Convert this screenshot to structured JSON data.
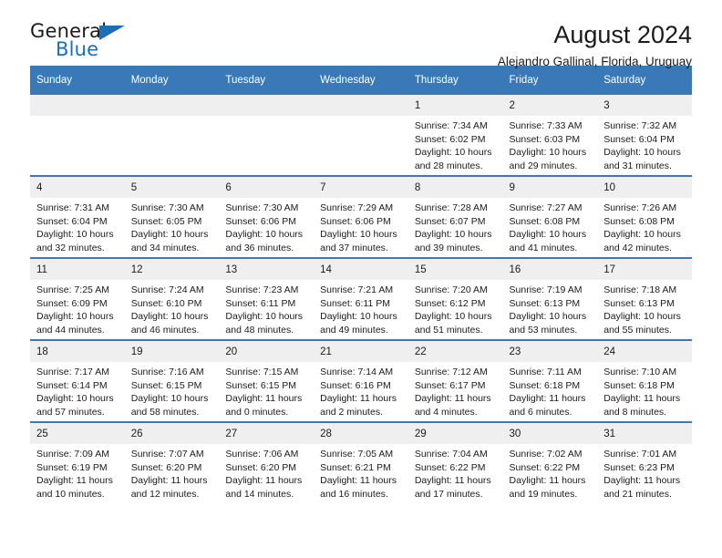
{
  "logo": {
    "word_top": "General",
    "word_bottom": "Blue",
    "icon": "triangle-icon",
    "accent_color": "#1a70b8"
  },
  "header": {
    "title": "August 2024",
    "subtitle": "Alejandro Gallinal, Florida, Uruguay"
  },
  "theme": {
    "header_blue": "#3a79b8",
    "daynum_gray": "#efefef",
    "text": "#1b1b1b"
  },
  "weekday_headers": [
    "Sunday",
    "Monday",
    "Tuesday",
    "Wednesday",
    "Thursday",
    "Friday",
    "Saturday"
  ],
  "weeks": [
    [
      {
        "day": "",
        "empty": true
      },
      {
        "day": "",
        "empty": true
      },
      {
        "day": "",
        "empty": true
      },
      {
        "day": "",
        "empty": true
      },
      {
        "day": "1",
        "sunrise": "Sunrise: 7:34 AM",
        "sunset": "Sunset: 6:02 PM",
        "daylight1": "Daylight: 10 hours",
        "daylight2": "and 28 minutes."
      },
      {
        "day": "2",
        "sunrise": "Sunrise: 7:33 AM",
        "sunset": "Sunset: 6:03 PM",
        "daylight1": "Daylight: 10 hours",
        "daylight2": "and 29 minutes."
      },
      {
        "day": "3",
        "sunrise": "Sunrise: 7:32 AM",
        "sunset": "Sunset: 6:04 PM",
        "daylight1": "Daylight: 10 hours",
        "daylight2": "and 31 minutes."
      }
    ],
    [
      {
        "day": "4",
        "sunrise": "Sunrise: 7:31 AM",
        "sunset": "Sunset: 6:04 PM",
        "daylight1": "Daylight: 10 hours",
        "daylight2": "and 32 minutes."
      },
      {
        "day": "5",
        "sunrise": "Sunrise: 7:30 AM",
        "sunset": "Sunset: 6:05 PM",
        "daylight1": "Daylight: 10 hours",
        "daylight2": "and 34 minutes."
      },
      {
        "day": "6",
        "sunrise": "Sunrise: 7:30 AM",
        "sunset": "Sunset: 6:06 PM",
        "daylight1": "Daylight: 10 hours",
        "daylight2": "and 36 minutes."
      },
      {
        "day": "7",
        "sunrise": "Sunrise: 7:29 AM",
        "sunset": "Sunset: 6:06 PM",
        "daylight1": "Daylight: 10 hours",
        "daylight2": "and 37 minutes."
      },
      {
        "day": "8",
        "sunrise": "Sunrise: 7:28 AM",
        "sunset": "Sunset: 6:07 PM",
        "daylight1": "Daylight: 10 hours",
        "daylight2": "and 39 minutes."
      },
      {
        "day": "9",
        "sunrise": "Sunrise: 7:27 AM",
        "sunset": "Sunset: 6:08 PM",
        "daylight1": "Daylight: 10 hours",
        "daylight2": "and 41 minutes."
      },
      {
        "day": "10",
        "sunrise": "Sunrise: 7:26 AM",
        "sunset": "Sunset: 6:08 PM",
        "daylight1": "Daylight: 10 hours",
        "daylight2": "and 42 minutes."
      }
    ],
    [
      {
        "day": "11",
        "sunrise": "Sunrise: 7:25 AM",
        "sunset": "Sunset: 6:09 PM",
        "daylight1": "Daylight: 10 hours",
        "daylight2": "and 44 minutes."
      },
      {
        "day": "12",
        "sunrise": "Sunrise: 7:24 AM",
        "sunset": "Sunset: 6:10 PM",
        "daylight1": "Daylight: 10 hours",
        "daylight2": "and 46 minutes."
      },
      {
        "day": "13",
        "sunrise": "Sunrise: 7:23 AM",
        "sunset": "Sunset: 6:11 PM",
        "daylight1": "Daylight: 10 hours",
        "daylight2": "and 48 minutes."
      },
      {
        "day": "14",
        "sunrise": "Sunrise: 7:21 AM",
        "sunset": "Sunset: 6:11 PM",
        "daylight1": "Daylight: 10 hours",
        "daylight2": "and 49 minutes."
      },
      {
        "day": "15",
        "sunrise": "Sunrise: 7:20 AM",
        "sunset": "Sunset: 6:12 PM",
        "daylight1": "Daylight: 10 hours",
        "daylight2": "and 51 minutes."
      },
      {
        "day": "16",
        "sunrise": "Sunrise: 7:19 AM",
        "sunset": "Sunset: 6:13 PM",
        "daylight1": "Daylight: 10 hours",
        "daylight2": "and 53 minutes."
      },
      {
        "day": "17",
        "sunrise": "Sunrise: 7:18 AM",
        "sunset": "Sunset: 6:13 PM",
        "daylight1": "Daylight: 10 hours",
        "daylight2": "and 55 minutes."
      }
    ],
    [
      {
        "day": "18",
        "sunrise": "Sunrise: 7:17 AM",
        "sunset": "Sunset: 6:14 PM",
        "daylight1": "Daylight: 10 hours",
        "daylight2": "and 57 minutes."
      },
      {
        "day": "19",
        "sunrise": "Sunrise: 7:16 AM",
        "sunset": "Sunset: 6:15 PM",
        "daylight1": "Daylight: 10 hours",
        "daylight2": "and 58 minutes."
      },
      {
        "day": "20",
        "sunrise": "Sunrise: 7:15 AM",
        "sunset": "Sunset: 6:15 PM",
        "daylight1": "Daylight: 11 hours",
        "daylight2": "and 0 minutes."
      },
      {
        "day": "21",
        "sunrise": "Sunrise: 7:14 AM",
        "sunset": "Sunset: 6:16 PM",
        "daylight1": "Daylight: 11 hours",
        "daylight2": "and 2 minutes."
      },
      {
        "day": "22",
        "sunrise": "Sunrise: 7:12 AM",
        "sunset": "Sunset: 6:17 PM",
        "daylight1": "Daylight: 11 hours",
        "daylight2": "and 4 minutes."
      },
      {
        "day": "23",
        "sunrise": "Sunrise: 7:11 AM",
        "sunset": "Sunset: 6:18 PM",
        "daylight1": "Daylight: 11 hours",
        "daylight2": "and 6 minutes."
      },
      {
        "day": "24",
        "sunrise": "Sunrise: 7:10 AM",
        "sunset": "Sunset: 6:18 PM",
        "daylight1": "Daylight: 11 hours",
        "daylight2": "and 8 minutes."
      }
    ],
    [
      {
        "day": "25",
        "sunrise": "Sunrise: 7:09 AM",
        "sunset": "Sunset: 6:19 PM",
        "daylight1": "Daylight: 11 hours",
        "daylight2": "and 10 minutes."
      },
      {
        "day": "26",
        "sunrise": "Sunrise: 7:07 AM",
        "sunset": "Sunset: 6:20 PM",
        "daylight1": "Daylight: 11 hours",
        "daylight2": "and 12 minutes."
      },
      {
        "day": "27",
        "sunrise": "Sunrise: 7:06 AM",
        "sunset": "Sunset: 6:20 PM",
        "daylight1": "Daylight: 11 hours",
        "daylight2": "and 14 minutes."
      },
      {
        "day": "28",
        "sunrise": "Sunrise: 7:05 AM",
        "sunset": "Sunset: 6:21 PM",
        "daylight1": "Daylight: 11 hours",
        "daylight2": "and 16 minutes."
      },
      {
        "day": "29",
        "sunrise": "Sunrise: 7:04 AM",
        "sunset": "Sunset: 6:22 PM",
        "daylight1": "Daylight: 11 hours",
        "daylight2": "and 17 minutes."
      },
      {
        "day": "30",
        "sunrise": "Sunrise: 7:02 AM",
        "sunset": "Sunset: 6:22 PM",
        "daylight1": "Daylight: 11 hours",
        "daylight2": "and 19 minutes."
      },
      {
        "day": "31",
        "sunrise": "Sunrise: 7:01 AM",
        "sunset": "Sunset: 6:23 PM",
        "daylight1": "Daylight: 11 hours",
        "daylight2": "and 21 minutes."
      }
    ]
  ]
}
